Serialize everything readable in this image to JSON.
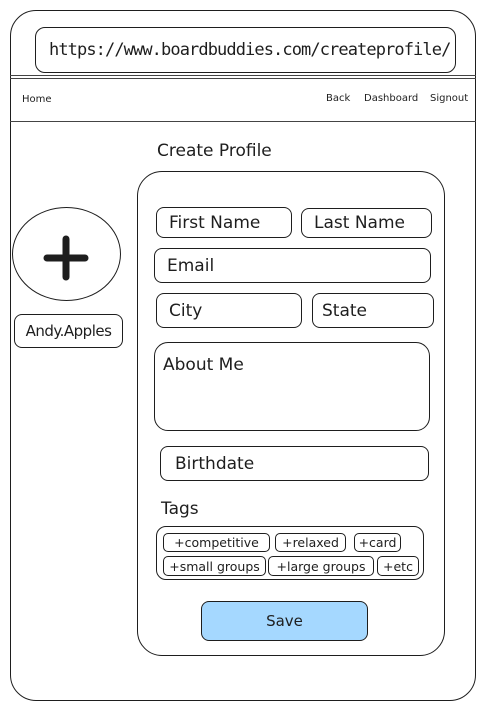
{
  "browser": {
    "url": "https://www.boardbuddies.com/createprofile/"
  },
  "nav": {
    "home": "Home",
    "back": "Back",
    "dashboard": "Dashboard",
    "signout": "Signout"
  },
  "page": {
    "title": "Create Profile"
  },
  "avatar": {
    "icon": "plus-icon",
    "username": "Andy.Apples"
  },
  "form": {
    "first_name_placeholder": "First Name",
    "last_name_placeholder": "Last Name",
    "email_placeholder": "Email",
    "city_placeholder": "City",
    "state_placeholder": "State",
    "about_placeholder": "About Me",
    "birthdate_placeholder": "Birthdate",
    "tags_label": "Tags",
    "tags": [
      "+competitive",
      "+relaxed",
      "+card",
      "+small groups",
      "+large groups",
      "+etc"
    ],
    "save_label": "Save"
  },
  "colors": {
    "save_button": "#a5d8ff"
  }
}
